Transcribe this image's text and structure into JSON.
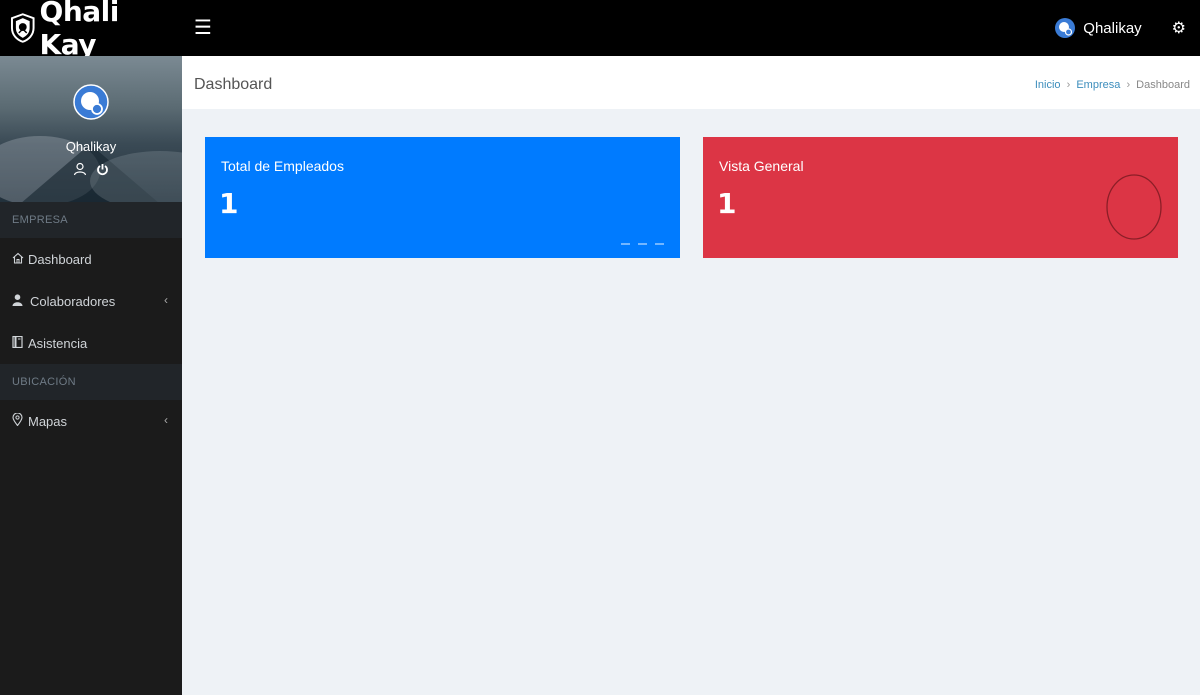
{
  "brand": {
    "name": "Qhali Kay"
  },
  "topbar": {
    "user_name": "Qhalikay"
  },
  "sidebar": {
    "profile_name": "Qhalikay",
    "sections": [
      {
        "header": "EMPRESA"
      },
      {
        "header": "UBICACIÓN"
      }
    ],
    "items": [
      {
        "label": "Dashboard",
        "icon": "home-icon"
      },
      {
        "label": "Colaboradores",
        "icon": "user-icon",
        "has_submenu": true
      },
      {
        "label": "Asistencia",
        "icon": "book-icon"
      },
      {
        "label": "Mapas",
        "icon": "map-pin-icon",
        "has_submenu": true
      }
    ]
  },
  "content": {
    "title": "Dashboard",
    "breadcrumb": {
      "home": "Inicio",
      "parent": "Empresa",
      "current": "Dashboard"
    }
  },
  "cards": [
    {
      "title": "Total de Empleados",
      "value": "1",
      "color": "#007bff"
    },
    {
      "title": "Vista General",
      "value": "1",
      "color": "#dc3545"
    }
  ],
  "colors": {
    "topbar": "#000000",
    "sidebar": "#1b1b1b",
    "background": "#eef2f6",
    "link": "#3c8dbc"
  }
}
